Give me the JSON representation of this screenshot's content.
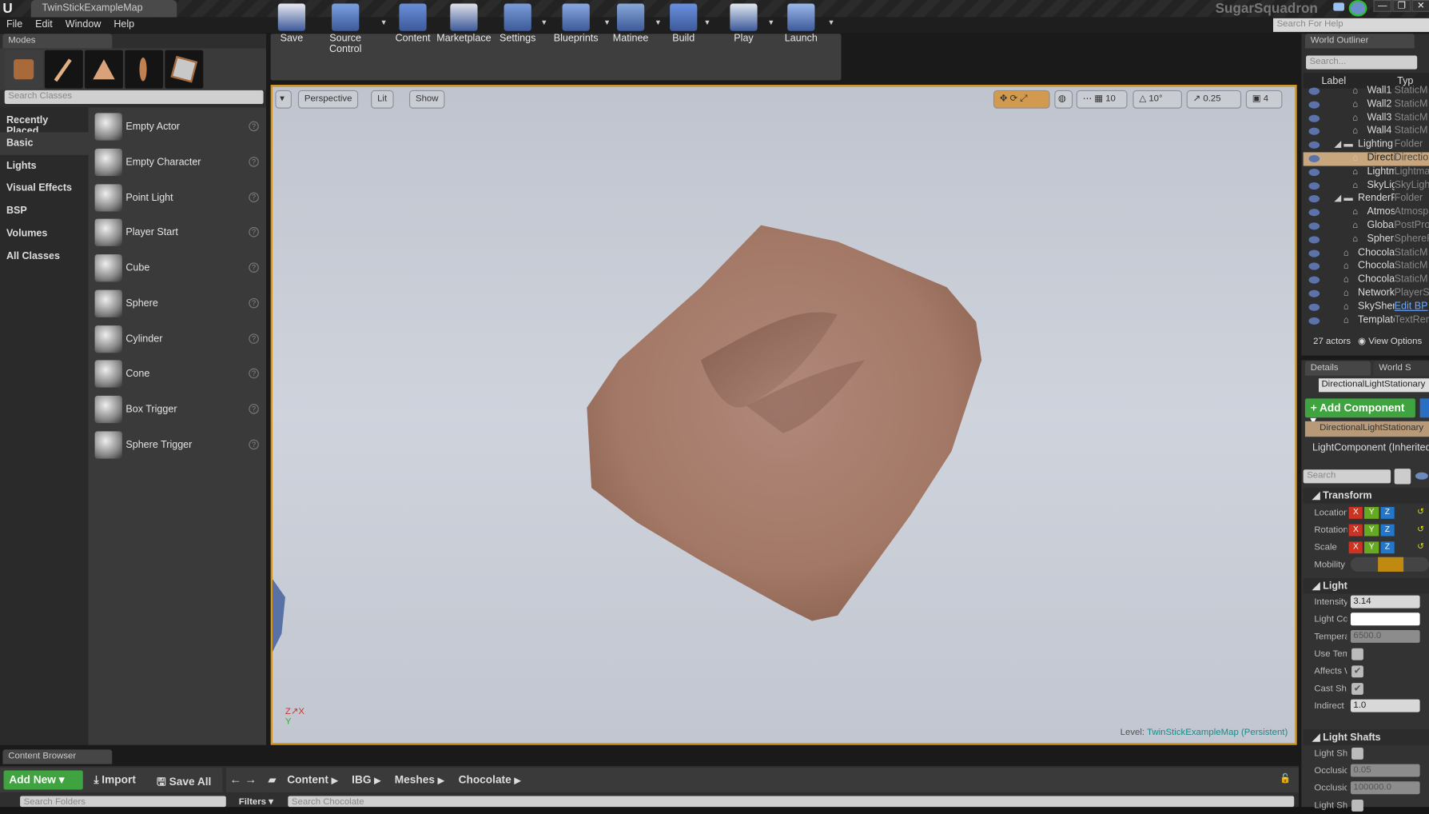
{
  "window": {
    "map_tab": "TwinStickExampleMap",
    "project": "SugarSquadron",
    "help_search_placeholder": "Search For Help",
    "min": "—",
    "max": "❐",
    "close": "✕"
  },
  "menu": [
    "File",
    "Edit",
    "Window",
    "Help"
  ],
  "modes": {
    "tab": "Modes",
    "search_placeholder": "Search Classes",
    "categories": [
      "Recently Placed",
      "Basic",
      "Lights",
      "Visual Effects",
      "BSP",
      "Volumes",
      "All Classes"
    ],
    "selected_category": "Basic",
    "items": [
      "Empty Actor",
      "Empty Character",
      "Point Light",
      "Player Start",
      "Cube",
      "Sphere",
      "Cylinder",
      "Cone",
      "Box Trigger",
      "Sphere Trigger"
    ]
  },
  "toolbar": [
    "Save",
    "Source Control",
    "Content",
    "Marketplace",
    "Settings",
    "Blueprints",
    "Matinee",
    "Build",
    "Play",
    "Launch"
  ],
  "viewport": {
    "perspective": "Perspective",
    "lit": "Lit",
    "show": "Show",
    "grid_snap": "10",
    "rot_snap": "10°",
    "scale_snap": "0.25",
    "cam_speed": "4",
    "level_label": "Level:",
    "level_name": "TwinStickExampleMap (Persistent)",
    "accent": "#d69a22"
  },
  "outliner": {
    "tab": "World Outliner",
    "search_placeholder": "Search...",
    "col_label": "Label",
    "col_type": "Typ",
    "rows": [
      {
        "label": "Wall1",
        "type": "StaticM",
        "indent": 2
      },
      {
        "label": "Wall2",
        "type": "StaticM",
        "indent": 2
      },
      {
        "label": "Wall3",
        "type": "StaticM",
        "indent": 2
      },
      {
        "label": "Wall4",
        "type": "StaticM",
        "indent": 2
      },
      {
        "label": "Lighting",
        "type": "Folder",
        "indent": 1
      },
      {
        "label": "Directi",
        "type": "Directio",
        "indent": 2,
        "selected": true
      },
      {
        "label": "Lightm",
        "type": "Lightma",
        "indent": 2
      },
      {
        "label": "SkyLig",
        "type": "SkyLigh",
        "indent": 2
      },
      {
        "label": "RenderF",
        "type": "Folder",
        "indent": 1
      },
      {
        "label": "Atmos",
        "type": "Atmosp",
        "indent": 2
      },
      {
        "label": "Global",
        "type": "PostPro",
        "indent": 2
      },
      {
        "label": "Sphere",
        "type": "SphereR",
        "indent": 2
      },
      {
        "label": "Chocolat",
        "type": "StaticM",
        "indent": 1
      },
      {
        "label": "Chocolat",
        "type": "StaticM",
        "indent": 1
      },
      {
        "label": "Chocolat",
        "type": "StaticM",
        "indent": 1
      },
      {
        "label": "NetworkP",
        "type": "PlayerS",
        "indent": 1
      },
      {
        "label": "SkyShere",
        "type": "Edit BP",
        "indent": 1,
        "link": true
      },
      {
        "label": "Template",
        "type": "TextRen",
        "indent": 1
      }
    ],
    "actor_count": "27 actors",
    "view_options": "View Options"
  },
  "details": {
    "tab": "Details",
    "tab2": "World S",
    "actor_name": "DirectionalLightStationary",
    "add_component": "+ Add Component ▾",
    "component_root": "DirectionalLightStationary",
    "component_child": "LightComponent (Inherited)",
    "search_placeholder": "Search",
    "transform": {
      "title": "Transform",
      "rows": [
        "Location",
        "Rotation",
        "Scale"
      ],
      "mobility": "Mobility"
    },
    "light": {
      "title": "Light",
      "intensity_label": "Intensity",
      "intensity": "3.14",
      "color_label": "Light Color",
      "temp_label": "Temperature",
      "temp": "6500.0",
      "use_temp_label": "Use Temperature",
      "affects_label": "Affects World",
      "cast_label": "Cast Shadows",
      "indirect_label": "Indirect Lighting",
      "indirect": "1.0"
    },
    "shafts": {
      "title": "Light Shafts",
      "ls_label": "Light Shaft Occlusion",
      "occ1_label": "Occlusion Mask Darkness",
      "occ1": "0.05",
      "occ2_label": "Occlusion Depth Range",
      "occ2": "100000.0",
      "ls2_label": "Light Shaft Bloom"
    }
  },
  "content_browser": {
    "tab": "Content Browser",
    "add_new": "Add New ▾",
    "import": "Import",
    "save_all": "Save All",
    "path": [
      "Content",
      "IBG",
      "Meshes",
      "Chocolate"
    ],
    "folder_search_placeholder": "Search Folders",
    "filters": "Filters ▾",
    "asset_search_placeholder": "Search Chocolate"
  }
}
